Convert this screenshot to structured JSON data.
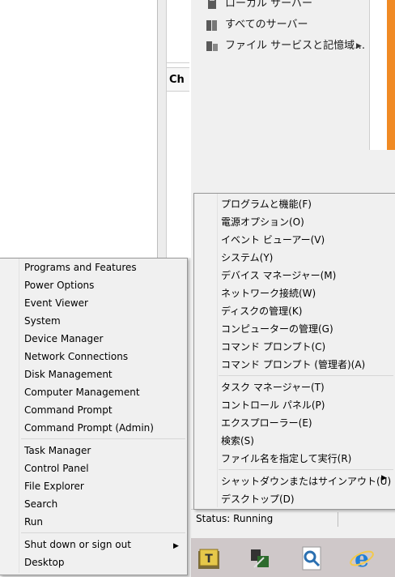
{
  "nav": {
    "items": [
      {
        "label": "ローカル サーバー",
        "icon": "server-icon"
      },
      {
        "label": "すべてのサーバー",
        "icon": "servers-icon"
      },
      {
        "label": "ファイル サービスと記憶域…",
        "icon": "file-services-icon"
      }
    ]
  },
  "inner_header": "Ch",
  "status": {
    "text": "Status: Running"
  },
  "jp_menu": {
    "group1": [
      "プログラムと機能(F)",
      "電源オプション(O)",
      "イベント ビューアー(V)",
      "システム(Y)",
      "デバイス マネージャー(M)",
      "ネットワーク接続(W)",
      "ディスクの管理(K)",
      "コンピューターの管理(G)",
      "コマンド プロンプト(C)",
      "コマンド プロンプト (管理者)(A)"
    ],
    "group2": [
      "タスク マネージャー(T)",
      "コントロール パネル(P)",
      "エクスプローラー(E)",
      "検索(S)",
      "ファイル名を指定して実行(R)"
    ],
    "group3": [
      "シャットダウンまたはサインアウト(U)",
      "デスクトップ(D)"
    ]
  },
  "en_menu": {
    "group1": [
      "Programs and Features",
      "Power Options",
      "Event Viewer",
      "System",
      "Device Manager",
      "Network Connections",
      "Disk Management",
      "Computer Management",
      "Command Prompt",
      "Command Prompt (Admin)"
    ],
    "group2": [
      "Task Manager",
      "Control Panel",
      "File Explorer",
      "Search",
      "Run"
    ],
    "group3": [
      "Shut down or sign out",
      "Desktop"
    ]
  },
  "taskbar": {
    "buttons": [
      "notepad-icon",
      "network-transfer-icon",
      "search-magnifier-icon",
      "internet-explorer-icon"
    ]
  },
  "colors": {
    "accent_orange": "#f08a24",
    "ie_blue": "#1e7fd8"
  }
}
